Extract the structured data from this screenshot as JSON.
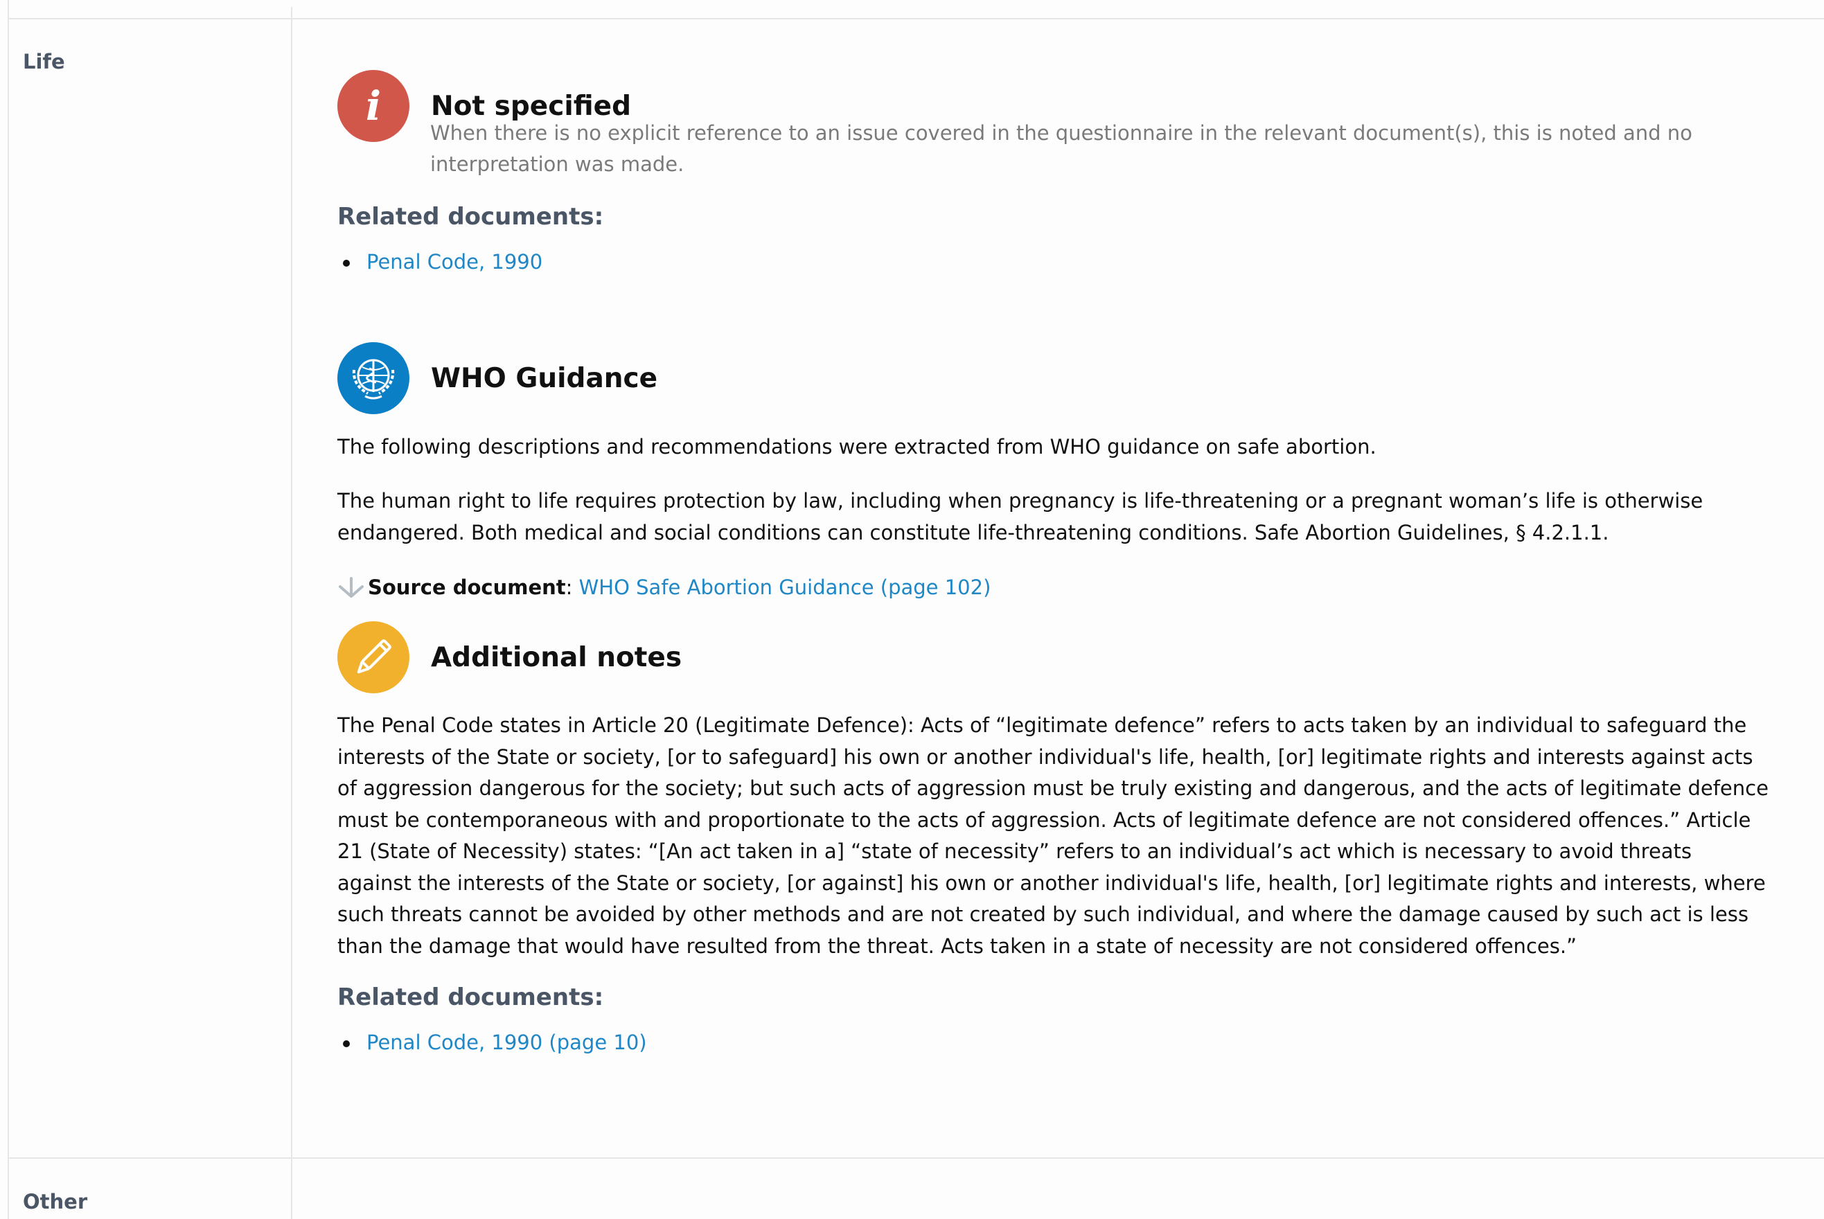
{
  "rows": {
    "life_label": "Life",
    "other_label": "Other"
  },
  "not_specified": {
    "icon": "info-icon",
    "title": "Not specified",
    "description": "When there is no explicit reference to an issue covered in the questionnaire in the relevant document(s), this is noted and no interpretation was made.",
    "related_heading": "Related documents:",
    "related_documents": [
      "Penal Code, 1990"
    ]
  },
  "who_guidance": {
    "icon": "who-emblem-icon",
    "title": "WHO Guidance",
    "intro": "The following descriptions and recommendations were extracted from WHO guidance on safe abortion.",
    "body": "The human right to life requires protection by law, including when pregnancy is life-threatening or a pregnant woman’s life is otherwise endangered. Both medical and social conditions can constitute life-threatening conditions. Safe Abortion Guidelines, § 4.2.1.1.",
    "source_label": "Source document",
    "source_separator": ":",
    "source_link": "WHO Safe Abortion Guidance (page 102)"
  },
  "additional_notes": {
    "icon": "pencil-icon",
    "title": "Additional notes",
    "body": "The Penal Code states in Article 20 (Legitimate Defence): Acts of “legitimate defence” refers to acts taken by an individual to safeguard the interests of the State or society, [or to safeguard] his own or another individual's life, health, [or] legitimate rights and interests against acts of aggression dangerous for the society; but such acts of aggression must be truly existing and dangerous, and the acts of legitimate defence must be contemporaneous with and proportionate to the acts of aggression. Acts of legitimate defence are not considered offences.” Article 21 (State of Necessity) states: “[An act taken in a] “state of necessity” refers to an individual’s act which is necessary to avoid threats against the interests of the State or society, [or against] his own or another individual's life, health, [or] legitimate rights and interests, where such threats cannot be avoided by other methods and are not created by such individual, and where the damage caused by such act is less than the damage that would have resulted from the threat. Acts taken in a state of necessity are not considered offences.”",
    "related_heading": "Related documents:",
    "related_documents": [
      "Penal Code, 1990 (page 10)"
    ]
  },
  "colors": {
    "info_red": "#d2574b",
    "who_blue": "#0a7fc6",
    "notes_yellow": "#f2b12c",
    "link_blue": "#2087c6",
    "label_slate": "#4a5565"
  }
}
